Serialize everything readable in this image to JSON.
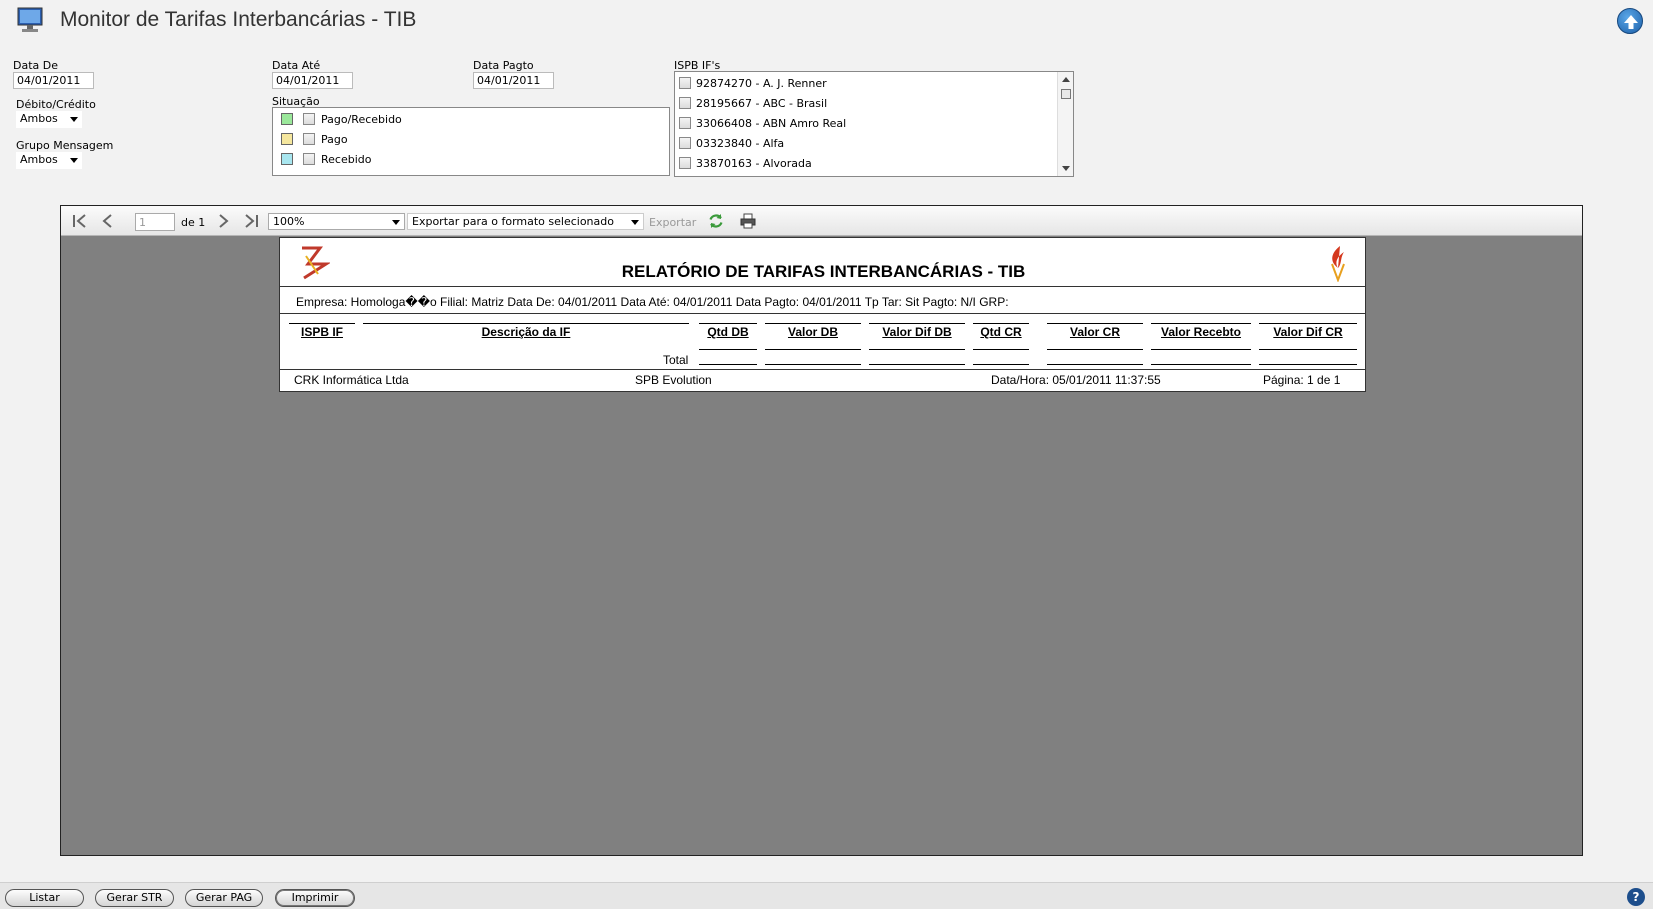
{
  "window": {
    "title": "Monitor de Tarifas Interbancárias - TIB"
  },
  "filters": {
    "data_de": {
      "label": "Data De",
      "value": "04/01/2011"
    },
    "data_ate": {
      "label": "Data Até",
      "value": "04/01/2011"
    },
    "data_pagto": {
      "label": "Data Pagto",
      "value": "04/01/2011"
    },
    "debito_credito": {
      "label": "Débito/Crédito",
      "value": "Ambos"
    },
    "grupo_mensagem": {
      "label": "Grupo Mensagem",
      "value": "Ambos"
    },
    "situacao": {
      "label": "Situação",
      "items": [
        {
          "label": "Pago/Recebido",
          "color": "#9be89b",
          "checked": false
        },
        {
          "label": "Pago",
          "color": "#f5e79e",
          "checked": false
        },
        {
          "label": "Recebido",
          "color": "#a8e6ef",
          "checked": false
        }
      ]
    },
    "ispb": {
      "label": "ISPB IF's",
      "items": [
        {
          "label": "92874270 - A. J. Renner",
          "checked": false
        },
        {
          "label": "28195667 - ABC - Brasil",
          "checked": false
        },
        {
          "label": "33066408 - ABN Amro Real",
          "checked": false
        },
        {
          "label": "03323840 - Alfa",
          "checked": false
        },
        {
          "label": "33870163 - Alvorada",
          "checked": false
        }
      ]
    }
  },
  "viewer": {
    "page": "1",
    "page_of": "de 1",
    "zoom": "100%",
    "export_format": "Exportar para o formato selecionado",
    "export_label": "Exportar"
  },
  "report": {
    "title": "RELATÓRIO DE TARIFAS INTERBANCÁRIAS - TIB",
    "info": "Empresa: Homologa��o Filial: Matriz Data De: 04/01/2011 Data Até: 04/01/2011 Data Pagto: 04/01/2011 Tp Tar: Sit Pagto: N/I GRP:",
    "columns": [
      "ISPB IF",
      "Descrição da IF",
      "Qtd DB",
      "Valor DB",
      "Valor Dif DB",
      "Qtd CR",
      "Valor CR",
      "Valor Recebto",
      "Valor Dif CR"
    ],
    "total_label": "Total",
    "footer": {
      "company": "CRK Informática Ltda",
      "product": "SPB Evolution",
      "datetime": "Data/Hora: 05/01/2011 11:37:55",
      "page": "Página: 1 de 1"
    }
  },
  "buttons": {
    "listar": "Listar",
    "gerar_str": "Gerar STR",
    "gerar_pag": "Gerar PAG",
    "imprimir": "Imprimir"
  },
  "help": "?",
  "icons": [
    "monitor-icon",
    "up-arrow-icon",
    "first-page-icon",
    "prev-page-icon",
    "next-page-icon",
    "last-page-icon",
    "refresh-icon",
    "print-icon",
    "help-icon"
  ]
}
